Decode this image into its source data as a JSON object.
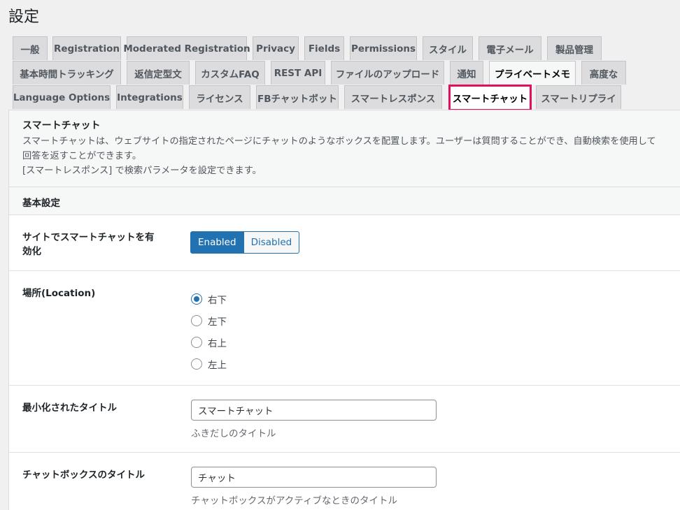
{
  "page": {
    "title": "設定"
  },
  "tabs": {
    "row1": [
      "一般",
      "Registration",
      "Moderated Registration",
      "Privacy",
      "Fields",
      "Permissions",
      "スタイル",
      "電子メール",
      "製品管理"
    ],
    "row2": [
      "基本時間トラッキング",
      "返信定型文",
      "カスタムFAQ",
      "REST API",
      "ファイルのアップロード",
      "通知",
      "プライベートメモ",
      "高度な"
    ],
    "row3": [
      "Language Options",
      "Integrations",
      "ライセンス",
      "FBチャットボット",
      "スマートレスポンス",
      "スマートチャット",
      "スマートリプライ"
    ],
    "active": "スマートチャット"
  },
  "intro": {
    "heading": "スマートチャット",
    "description": "スマートチャットは、ウェブサイトの指定されたページにチャットのようなボックスを配置します。ユーザーは質問することができ、自動検索を使用して回答を返すことができます。",
    "note": "[スマートレスポンス] で検索パラメータを設定できます。"
  },
  "section": {
    "title": "基本設定"
  },
  "fields": {
    "enable": {
      "label": "サイトでスマートチャットを有効化",
      "on_label": "Enabled",
      "off_label": "Disabled",
      "value": "Enabled"
    },
    "location": {
      "label": "場所(Location)",
      "options": [
        "右下",
        "左下",
        "右上",
        "左上"
      ],
      "selected": "右下"
    },
    "minimized_title": {
      "label": "最小化されたタイトル",
      "value": "スマートチャット",
      "help": "ふきだしのタイトル"
    },
    "chatbox_title": {
      "label": "チャットボックスのタイトル",
      "value": "チャット",
      "help": "チャットボックスがアクティブなときのタイトル"
    }
  },
  "colors": {
    "accent": "#2271b1",
    "highlight": "#e1105e"
  }
}
